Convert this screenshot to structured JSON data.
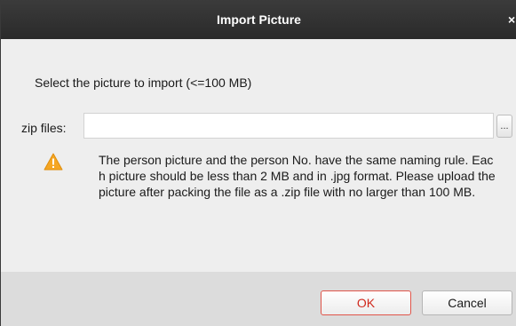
{
  "dialog": {
    "title": "Import Picture",
    "close_glyph": "×",
    "prompt": "Select the picture to import (<=100 MB)",
    "file_field": {
      "label": "zip files:",
      "value": "",
      "browse_label": "..."
    },
    "warning_icon": "warning-triangle-icon",
    "note_text": "The person picture and the person No. have the same naming rule. Each picture should be less than 2 MB and in .jpg format. Please upload the picture after packing the file as a .zip file with no larger than 100 MB.",
    "buttons": {
      "ok": "OK",
      "cancel": "Cancel"
    }
  },
  "colors": {
    "titlebar": "#333333",
    "body": "#eeeeee",
    "footer": "#dcdcdc",
    "ok_accent": "#d0281c",
    "warning": "#f5a623"
  }
}
